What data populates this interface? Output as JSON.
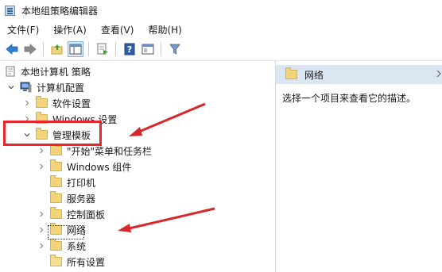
{
  "window": {
    "title": "本地组策略编辑器"
  },
  "menu": {
    "items": [
      "文件(F)",
      "操作(A)",
      "查看(V)",
      "帮助(H)"
    ]
  },
  "toolbar": {
    "buttons": [
      "back-arrow-icon",
      "forward-arrow-icon",
      "up-folder-icon",
      "show-hide-tree-icon",
      "export-list-icon",
      "help-icon",
      "properties-icon",
      "filter-icon"
    ]
  },
  "tree": {
    "root": "本地计算机 策略",
    "computer_config": "计算机配置",
    "software_settings": "软件设置",
    "windows_settings": "Windows 设置",
    "admin_templates": "管理模板",
    "start_menu": "\"开始\"菜单和任务栏",
    "windows_components": "Windows 组件",
    "printers": "打印机",
    "servers": "服务器",
    "control_panel": "控制面板",
    "network": "网络",
    "system": "系统",
    "all_settings": "所有设置"
  },
  "right_pane": {
    "header": "网络",
    "description": "选择一个项目来查看它的描述。"
  },
  "colors": {
    "highlight_box": "#e8262b",
    "arrow": "#d9262c",
    "header_bg": "#dbe6f3",
    "folder": "#f2d47a"
  }
}
